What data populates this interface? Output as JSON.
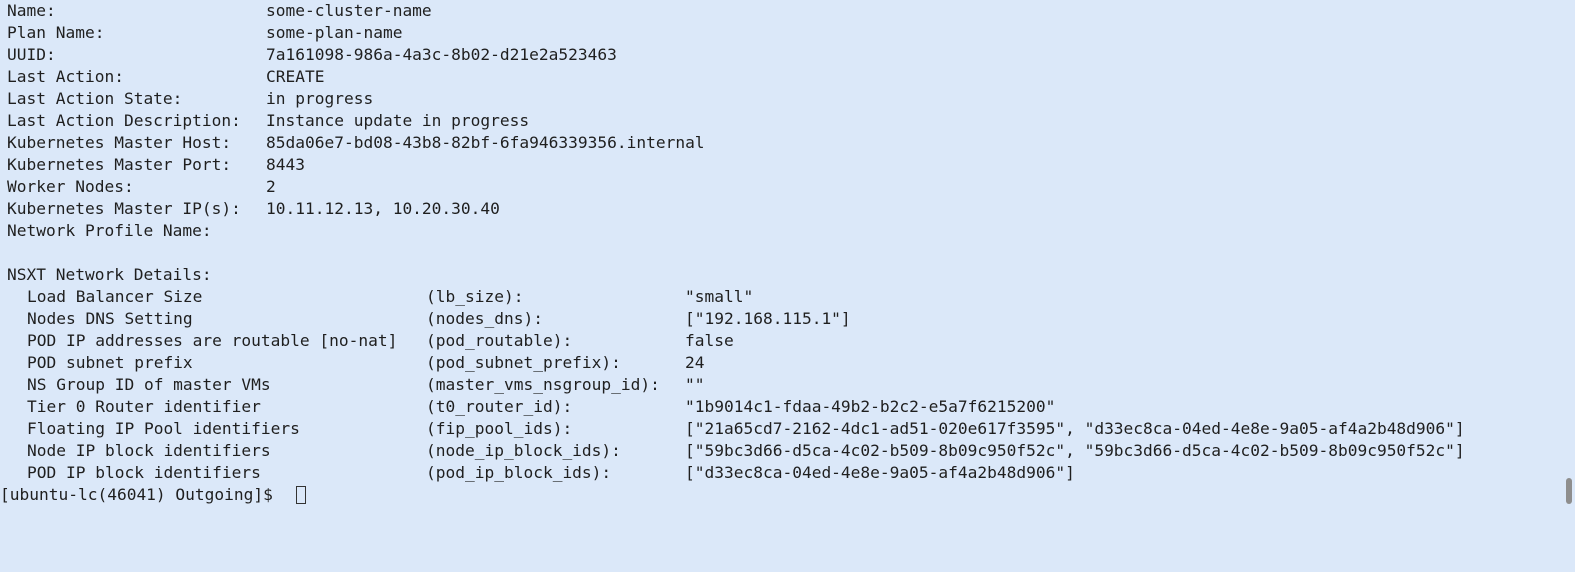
{
  "summary": [
    {
      "label": "Name:",
      "value": "some-cluster-name"
    },
    {
      "label": "Plan Name:",
      "value": "some-plan-name"
    },
    {
      "label": "UUID:",
      "value": "7a161098-986a-4a3c-8b02-d21e2a523463"
    },
    {
      "label": "Last Action:",
      "value": "CREATE"
    },
    {
      "label": "Last Action State:",
      "value": "in progress"
    },
    {
      "label": "Last Action Description:",
      "value": "Instance update in progress"
    },
    {
      "label": "Kubernetes Master Host:",
      "value": "85da06e7-bd08-43b8-82bf-6fa946339356.internal"
    },
    {
      "label": "Kubernetes Master Port:",
      "value": "8443"
    },
    {
      "label": "Worker Nodes:",
      "value": "2"
    },
    {
      "label": "Kubernetes Master IP(s):",
      "value": "10.11.12.13, 10.20.30.40"
    },
    {
      "label": "Network Profile Name:",
      "value": ""
    }
  ],
  "nsxt": {
    "heading": "NSXT Network Details:",
    "rows": [
      {
        "desc": "Load Balancer Size",
        "key": "(lb_size):",
        "value": "\"small\""
      },
      {
        "desc": "Nodes DNS Setting",
        "key": "(nodes_dns):",
        "value": "[\"192.168.115.1\"]"
      },
      {
        "desc": "POD IP addresses are routable [no-nat]",
        "key": "(pod_routable):",
        "value": "false"
      },
      {
        "desc": "POD subnet prefix",
        "key": "(pod_subnet_prefix):",
        "value": "24"
      },
      {
        "desc": "NS Group ID of master VMs",
        "key": "(master_vms_nsgroup_id):",
        "value": "\"\""
      },
      {
        "desc": "Tier 0 Router identifier",
        "key": "(t0_router_id):",
        "value": "\"1b9014c1-fdaa-49b2-b2c2-e5a7f6215200\""
      },
      {
        "desc": "Floating IP Pool identifiers",
        "key": "(fip_pool_ids):",
        "value": "[\"21a65cd7-2162-4dc1-ad51-020e617f3595\", \"d33ec8ca-04ed-4e8e-9a05-af4a2b48d906\"]"
      },
      {
        "desc": "Node IP block identifiers",
        "key": "(node_ip_block_ids):",
        "value": "[\"59bc3d66-d5ca-4c02-b509-8b09c950f52c\", \"59bc3d66-d5ca-4c02-b509-8b09c950f52c\"]"
      },
      {
        "desc": "POD IP block identifiers",
        "key": "(pod_ip_block_ids):",
        "value": "[\"d33ec8ca-04ed-4e8e-9a05-af4a2b48d906\"]"
      }
    ]
  },
  "prompt": "[ubuntu-lc(46041) Outgoing]$ ",
  "colors": {
    "background": "#dbe8f9",
    "text": "#1f1f1f"
  }
}
